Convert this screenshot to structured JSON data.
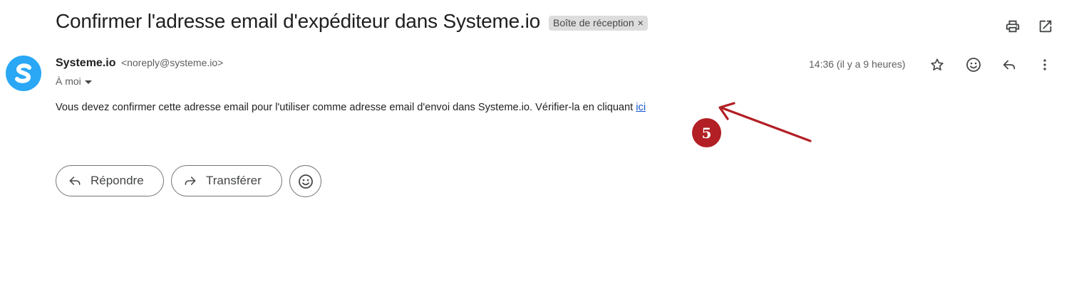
{
  "email": {
    "subject": "Confirmer l'adresse email d'expéditeur dans Systeme.io",
    "label": "Boîte de réception",
    "label_remove": "×",
    "sender": {
      "avatar_letter": "S",
      "name": "Systeme.io",
      "address": "<noreply@systeme.io>"
    },
    "to": "À moi",
    "time": "14:36 (il y a 9 heures)",
    "body_text": "Vous devez confirmer cette adresse email pour l'utiliser comme adresse email d'envoi dans Systeme.io. Vérifier-la en cliquant ",
    "body_link": "ici"
  },
  "annotation": {
    "badge_number": "5",
    "color": "#b21f24"
  },
  "actions": {
    "reply_label": "Répondre",
    "forward_label": "Transférer"
  },
  "icons": {
    "top": [
      "print-icon",
      "open-in-new-window-icon"
    ],
    "header": [
      "star-icon",
      "emoji-reaction-icon",
      "reply-icon",
      "more-vert-icon"
    ]
  },
  "colors": {
    "avatar": "#2aa7f5",
    "link": "#1155cc",
    "chip": "#dddddd"
  }
}
